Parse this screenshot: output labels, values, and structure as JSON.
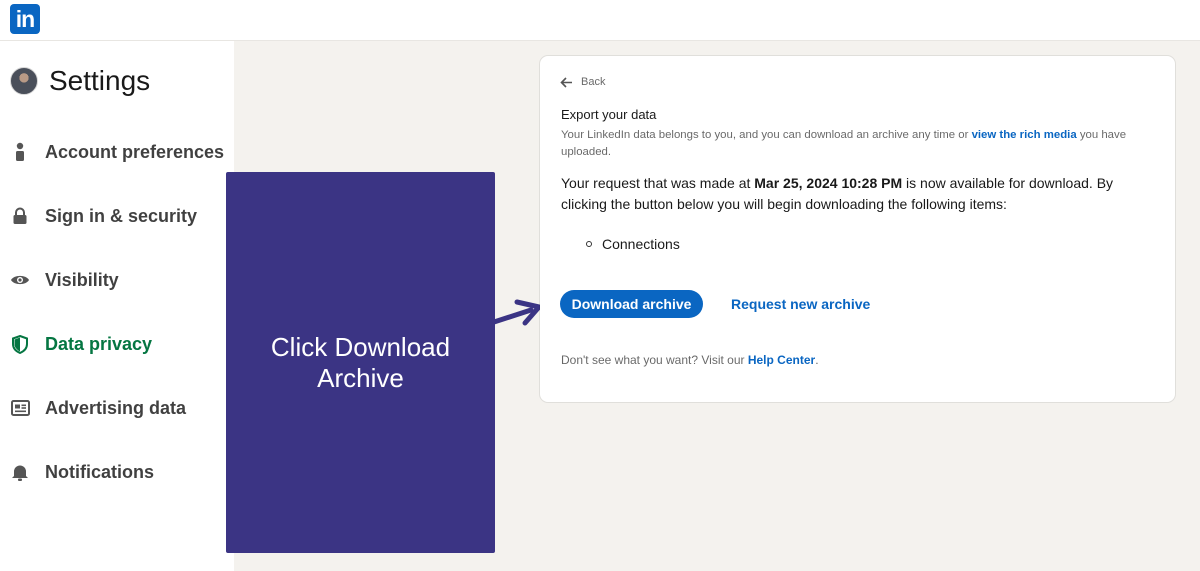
{
  "header": {
    "logo_text": "in"
  },
  "sidebar": {
    "title": "Settings",
    "items": [
      {
        "label": "Account preferences",
        "icon": "person-icon",
        "active": false
      },
      {
        "label": "Sign in & security",
        "icon": "lock-icon",
        "active": false
      },
      {
        "label": "Visibility",
        "icon": "eye-icon",
        "active": false
      },
      {
        "label": "Data privacy",
        "icon": "shield-icon",
        "active": true
      },
      {
        "label": "Advertising data",
        "icon": "newspaper-icon",
        "active": false
      },
      {
        "label": "Notifications",
        "icon": "bell-icon",
        "active": false
      }
    ]
  },
  "overlay": {
    "text": "Click Download Archive"
  },
  "card": {
    "back_label": "Back",
    "title": "Export your data",
    "desc_before": "Your LinkedIn data belongs to you, and you can download an archive any time or ",
    "desc_link": "view the rich media",
    "desc_after": " you have uploaded.",
    "msg_before": "Your request that was made at ",
    "msg_date": "Mar 25, 2024 10:28 PM",
    "msg_after": " is now available for download. By clicking the button below you will begin downloading the following items:",
    "items": [
      "Connections"
    ],
    "download_label": "Download archive",
    "request_label": "Request new archive",
    "help_before": "Don't see what you want? Visit our ",
    "help_link": "Help Center",
    "help_after": "."
  },
  "colors": {
    "brand": "#0a66c2",
    "active_nav": "#057642",
    "overlay": "#3b3484"
  }
}
